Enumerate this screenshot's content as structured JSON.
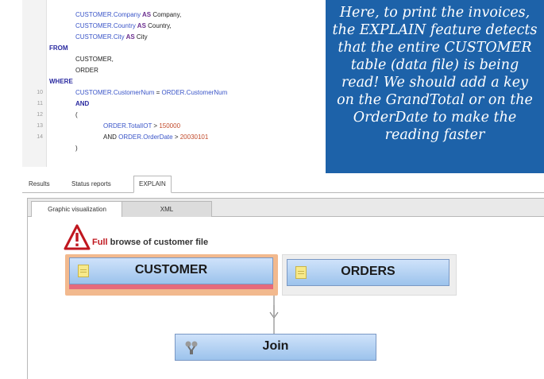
{
  "editor": {
    "lines": [
      {
        "num": "",
        "parts": [
          {
            "t": "CUSTOMER.Company",
            "c": "id"
          },
          {
            "t": " AS ",
            "c": "kwt"
          },
          {
            "t": "Company,",
            "c": "tx"
          }
        ]
      },
      {
        "num": "",
        "parts": [
          {
            "t": "CUSTOMER.Country",
            "c": "id"
          },
          {
            "t": " AS ",
            "c": "kwt"
          },
          {
            "t": "Country,",
            "c": "tx"
          }
        ]
      },
      {
        "num": "",
        "parts": [
          {
            "t": "CUSTOMER.City",
            "c": "id"
          },
          {
            "t": " AS ",
            "c": "kwt"
          },
          {
            "t": "City",
            "c": "tx"
          }
        ]
      },
      {
        "num": "",
        "parts": [
          {
            "t": "FROM",
            "c": "kw"
          }
        ]
      },
      {
        "num": "",
        "parts": [
          {
            "t": "CUSTOMER,",
            "c": "tx"
          }
        ]
      },
      {
        "num": "",
        "parts": [
          {
            "t": "ORDER",
            "c": "tx"
          }
        ]
      },
      {
        "num": "",
        "parts": [
          {
            "t": "WHERE",
            "c": "kw"
          }
        ]
      },
      {
        "num": "10",
        "parts": [
          {
            "t": "CUSTOMER.CustomerNum",
            "c": "id"
          },
          {
            "t": " = ",
            "c": "tx"
          },
          {
            "t": "ORDER.CustomerNum",
            "c": "id"
          }
        ]
      },
      {
        "num": "11",
        "parts": [
          {
            "t": "AND",
            "c": "kw"
          }
        ]
      },
      {
        "num": "12",
        "parts": [
          {
            "t": "(",
            "c": "tx"
          }
        ]
      },
      {
        "num": "13",
        "parts": [
          {
            "t": "ORDER.TotalIOT",
            "c": "id"
          },
          {
            "t": " > ",
            "c": "tx"
          },
          {
            "t": "150000",
            "c": "num"
          }
        ]
      },
      {
        "num": "14",
        "parts": [
          {
            "t": "AND ",
            "c": "tx"
          },
          {
            "t": "ORDER.OrderDate",
            "c": "id"
          },
          {
            "t": " > ",
            "c": "tx"
          },
          {
            "t": "20030101",
            "c": "num"
          }
        ]
      },
      {
        "num": "",
        "parts": [
          {
            "t": ")",
            "c": "tx"
          }
        ]
      }
    ]
  },
  "callout": {
    "lines": [
      "Here, to print the invoices,",
      "the EXPLAIN feature detects",
      "that the entire CUSTOMER",
      "table (data file) is being",
      "read! We should add a key",
      "on the GrandTotal or on the",
      "OrderDate to make the",
      "reading faster"
    ]
  },
  "tabs": {
    "results": "Results",
    "status_reports": "Status reports",
    "explain": "EXPLAIN"
  },
  "subtabs": {
    "graphic": "Graphic visualization",
    "xml": "XML"
  },
  "diagram": {
    "warning_prefix": "Full",
    "warning_rest": " browse of customer file",
    "node_customer": "CUSTOMER",
    "node_orders": "ORDERS",
    "node_join": "Join",
    "table_icon_text": "SQL"
  },
  "colors": {
    "callout_bg": "#1d62a9",
    "node_fill_top": "#cfe2fa",
    "node_fill_bottom": "#9cc3ec",
    "warning_red": "#c0171f",
    "full_scan_highlight": "#f2b98e"
  }
}
